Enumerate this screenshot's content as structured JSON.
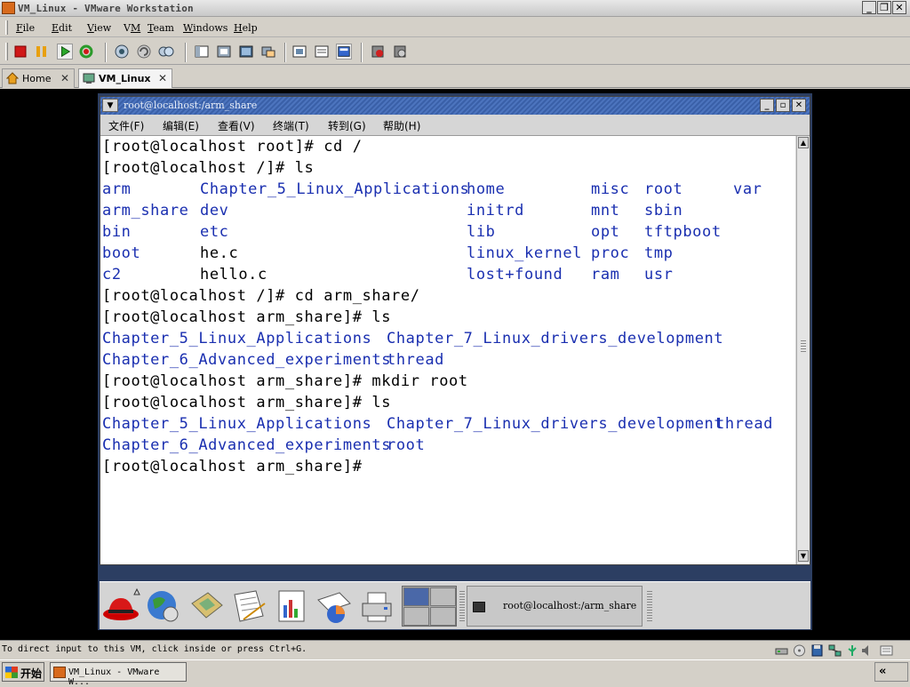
{
  "window": {
    "title": "VM_Linux - VMware Workstation",
    "controls": [
      "_",
      "❐",
      "✕"
    ]
  },
  "menubar": {
    "items": [
      {
        "label": "File",
        "mnemonic": "F"
      },
      {
        "label": "Edit",
        "mnemonic": "E"
      },
      {
        "label": "View",
        "mnemonic": "V"
      },
      {
        "label": "VM",
        "mnemonic": "M"
      },
      {
        "label": "Team",
        "mnemonic": "T"
      },
      {
        "label": "Windows",
        "mnemonic": "W"
      },
      {
        "label": "Help",
        "mnemonic": "H"
      }
    ]
  },
  "toolbar": {
    "buttons": [
      "power-off-icon",
      "suspend-icon",
      "power-on-icon",
      "reset-icon",
      "snapshot-icon",
      "revert-snapshot-icon",
      "snapshot-manager-icon",
      "sidebar-icon",
      "quick-switch-icon",
      "full-screen-icon",
      "console-view-icon",
      "summary-view-icon",
      "appliance-view-icon",
      "unity-icon",
      "team-icon"
    ]
  },
  "tabs": [
    {
      "label": "Home",
      "icon": "home-icon",
      "active": false
    },
    {
      "label": "VM_Linux",
      "icon": "vm-icon",
      "active": true
    }
  ],
  "terminal": {
    "title": "root@localhost:/arm_share",
    "menu": [
      "文件(F)",
      "编辑(E)",
      "查看(V)",
      "终端(T)",
      "转到(G)",
      "帮助(H)"
    ],
    "lines": [
      "[root@localhost root]# cd /",
      "[root@localhost /]# ls"
    ],
    "ls_root": [
      [
        "arm",
        "Chapter_5_Linux_Applications",
        "home",
        "misc",
        "root",
        "var"
      ],
      [
        "arm_share",
        "dev",
        "initrd",
        "mnt",
        "sbin",
        ""
      ],
      [
        "bin",
        "etc",
        "lib",
        "opt",
        "tftpboot",
        ""
      ],
      [
        "boot",
        "he.c",
        "linux_kernel",
        "proc",
        "tmp",
        ""
      ],
      [
        "c2",
        "hello.c",
        "lost+found",
        "ram",
        "usr",
        ""
      ]
    ],
    "lines2": [
      "[root@localhost /]# cd arm_share/",
      "[root@localhost arm_share]# ls"
    ],
    "ls_share1": [
      [
        "Chapter_5_Linux_Applications",
        "Chapter_7_Linux_drivers_development"
      ],
      [
        "Chapter_6_Advanced_experiments",
        "thread"
      ]
    ],
    "lines3": [
      "[root@localhost arm_share]# mkdir root",
      "[root@localhost arm_share]# ls"
    ],
    "ls_share2": [
      [
        "Chapter_5_Linux_Applications",
        "Chapter_7_Linux_drivers_development",
        "thread"
      ],
      [
        "Chapter_6_Advanced_experiments",
        "root",
        ""
      ]
    ],
    "prompt": "[root@localhost arm_share]#"
  },
  "panel": {
    "launchers": [
      "redhat-menu-icon",
      "web-browser-icon",
      "mail-icon",
      "writer-icon",
      "presentation-icon",
      "spreadsheet-icon",
      "print-manager-icon"
    ],
    "taskbutton": "root@localhost:/arm_share"
  },
  "status": {
    "text": "To direct input to this VM, click inside or press Ctrl+G.",
    "icons": [
      "network-icon",
      "cdrom-icon",
      "floppy-icon",
      "ethernet-icon",
      "usb-icon",
      "sound-icon",
      "message-icon"
    ]
  },
  "taskbar": {
    "start_label": "开始",
    "window_label": "VM_Linux - VMware W...",
    "tray_label": "«"
  }
}
